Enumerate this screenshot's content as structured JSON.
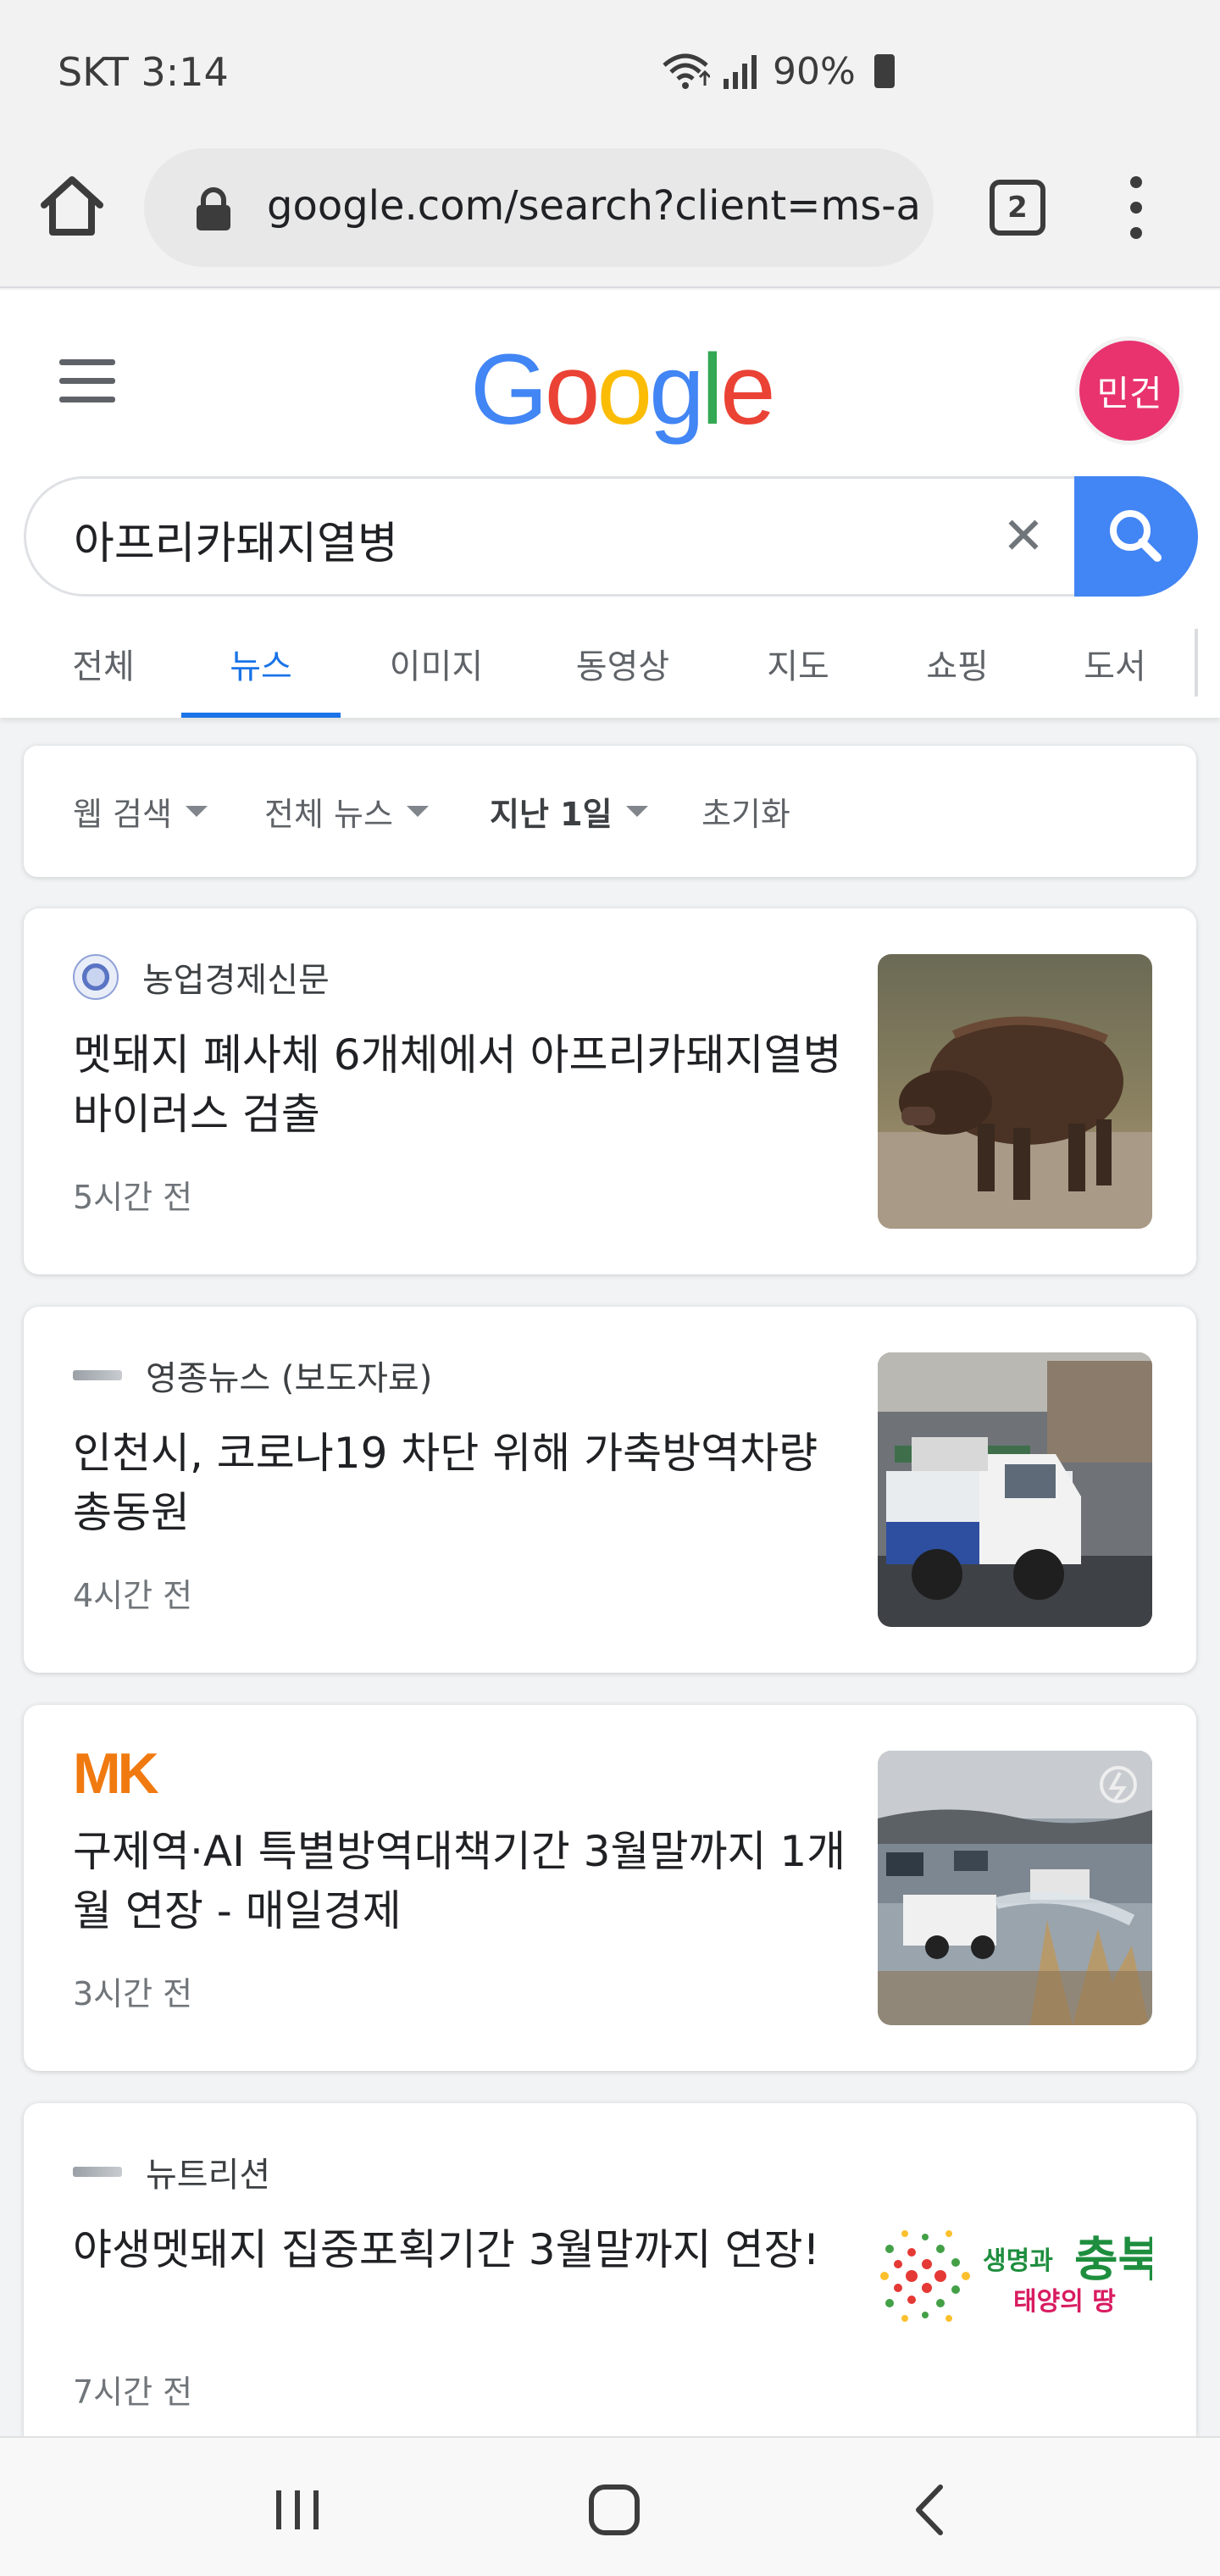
{
  "status_bar": {
    "carrier_time": "SKT 3:14",
    "battery": "90%"
  },
  "browser": {
    "url": "google.com/search?client=ms-an",
    "tab_count": "2"
  },
  "google": {
    "logo_letters": [
      "G",
      "o",
      "o",
      "g",
      "l",
      "e"
    ],
    "logo_colors": [
      "#4285f4",
      "#ea4335",
      "#fbbc05",
      "#4285f4",
      "#34a853",
      "#ea4335"
    ],
    "avatar_text": "민건",
    "avatar_color": "#e8336f",
    "search_query": "아프리카돼지열병",
    "tabs": [
      {
        "label": "전체",
        "active": false
      },
      {
        "label": "뉴스",
        "active": true
      },
      {
        "label": "이미지",
        "active": false
      },
      {
        "label": "동영상",
        "active": false
      },
      {
        "label": "지도",
        "active": false
      },
      {
        "label": "쇼핑",
        "active": false
      },
      {
        "label": "도서",
        "active": false
      }
    ]
  },
  "filters": {
    "web_search": "웹 검색",
    "all_news": "전체 뉴스",
    "past_day": "지난 1일",
    "reset": "초기화"
  },
  "news": [
    {
      "source": "농업경제신문",
      "favicon": "globe-icon",
      "title": "멧돼지 폐사체 6개체에서 아프리카돼지열병 바이러스 검출",
      "time": "5시간 전",
      "thumbnail": "wild-boar-photo"
    },
    {
      "source": "영종뉴스 (보도자료)",
      "favicon": "yeongjong-news-icon",
      "title": "인천시, 코로나19 차단 위해 가축방역차량 총동원",
      "time": "4시간 전",
      "thumbnail": "disinfection-truck-photo"
    },
    {
      "source": "MK",
      "favicon": "mk-logo-icon",
      "title": "구제역·AI 특별방역대책기간 3월말까지 1개월 연장 - 매일경제",
      "time": "3시간 전",
      "thumbnail": "spraying-truck-photo"
    },
    {
      "source": "뉴트리션",
      "favicon": "nutrition-icon",
      "title": "야생멧돼지 집중포획기간 3월말까지 연장!",
      "time": "7시간 전",
      "thumbnail": "chungbuk-logo-image"
    }
  ],
  "thumb_texts": {
    "chungbuk_line1": "생명과",
    "chungbuk_big": "충북",
    "chungbuk_line2": "태양의 땅"
  },
  "colors": {
    "accent_blue": "#1a73e8",
    "search_button": "#4285f4",
    "mk_orange": "#f07a10"
  }
}
